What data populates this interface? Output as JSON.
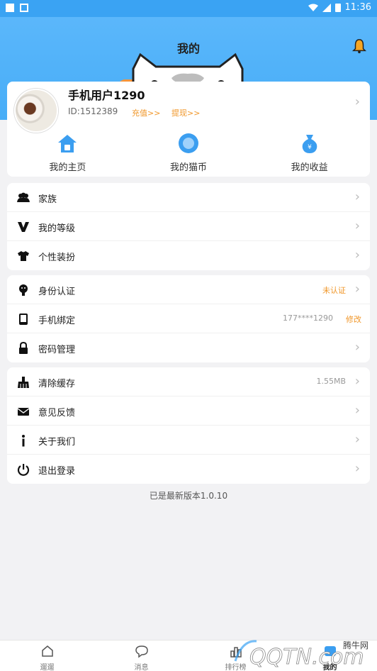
{
  "status_bar": {
    "time": "11:36"
  },
  "header": {
    "title": "我的",
    "icons": [
      "bell-icon"
    ]
  },
  "profile": {
    "username": "手机用户1290",
    "user_id": "ID:1512389",
    "recharge_label": "充值>>",
    "withdraw_label": "提现>>"
  },
  "shortcuts": [
    {
      "label": "我的主页",
      "icon": "home-icon"
    },
    {
      "label": "我的猫币",
      "icon": "coin-icon"
    },
    {
      "label": "我的收益",
      "icon": "money-bag-icon"
    }
  ],
  "group1": [
    {
      "label": "家族",
      "icon": "family-icon"
    },
    {
      "label": "我的等级",
      "icon": "level-icon"
    },
    {
      "label": "个性装扮",
      "icon": "tshirt-icon"
    }
  ],
  "group2": [
    {
      "label": "身份认证",
      "icon": "identity-icon",
      "value": "未认证"
    },
    {
      "label": "手机绑定",
      "icon": "phone-icon",
      "value": "177****1290",
      "action": "修改"
    },
    {
      "label": "密码管理",
      "icon": "lock-icon"
    }
  ],
  "group3": [
    {
      "label": "清除缓存",
      "icon": "broom-icon",
      "value": "1.55MB"
    },
    {
      "label": "意见反馈",
      "icon": "mail-icon"
    },
    {
      "label": "关于我们",
      "icon": "info-icon"
    },
    {
      "label": "退出登录",
      "icon": "power-icon"
    }
  ],
  "version_text": "已是最新版本1.0.10",
  "tabs": [
    {
      "label": "遛遛",
      "icon": "home-outline-icon"
    },
    {
      "label": "消息",
      "icon": "chat-bubble-icon"
    },
    {
      "label": "排行榜",
      "icon": "ranking-icon"
    },
    {
      "label": "我的",
      "icon": "profile-icon"
    }
  ],
  "watermark": {
    "text": "腾牛网",
    "logo_text": "QQTN.com"
  },
  "colors": {
    "header": "#47adf7",
    "accent": "#f0972a"
  }
}
